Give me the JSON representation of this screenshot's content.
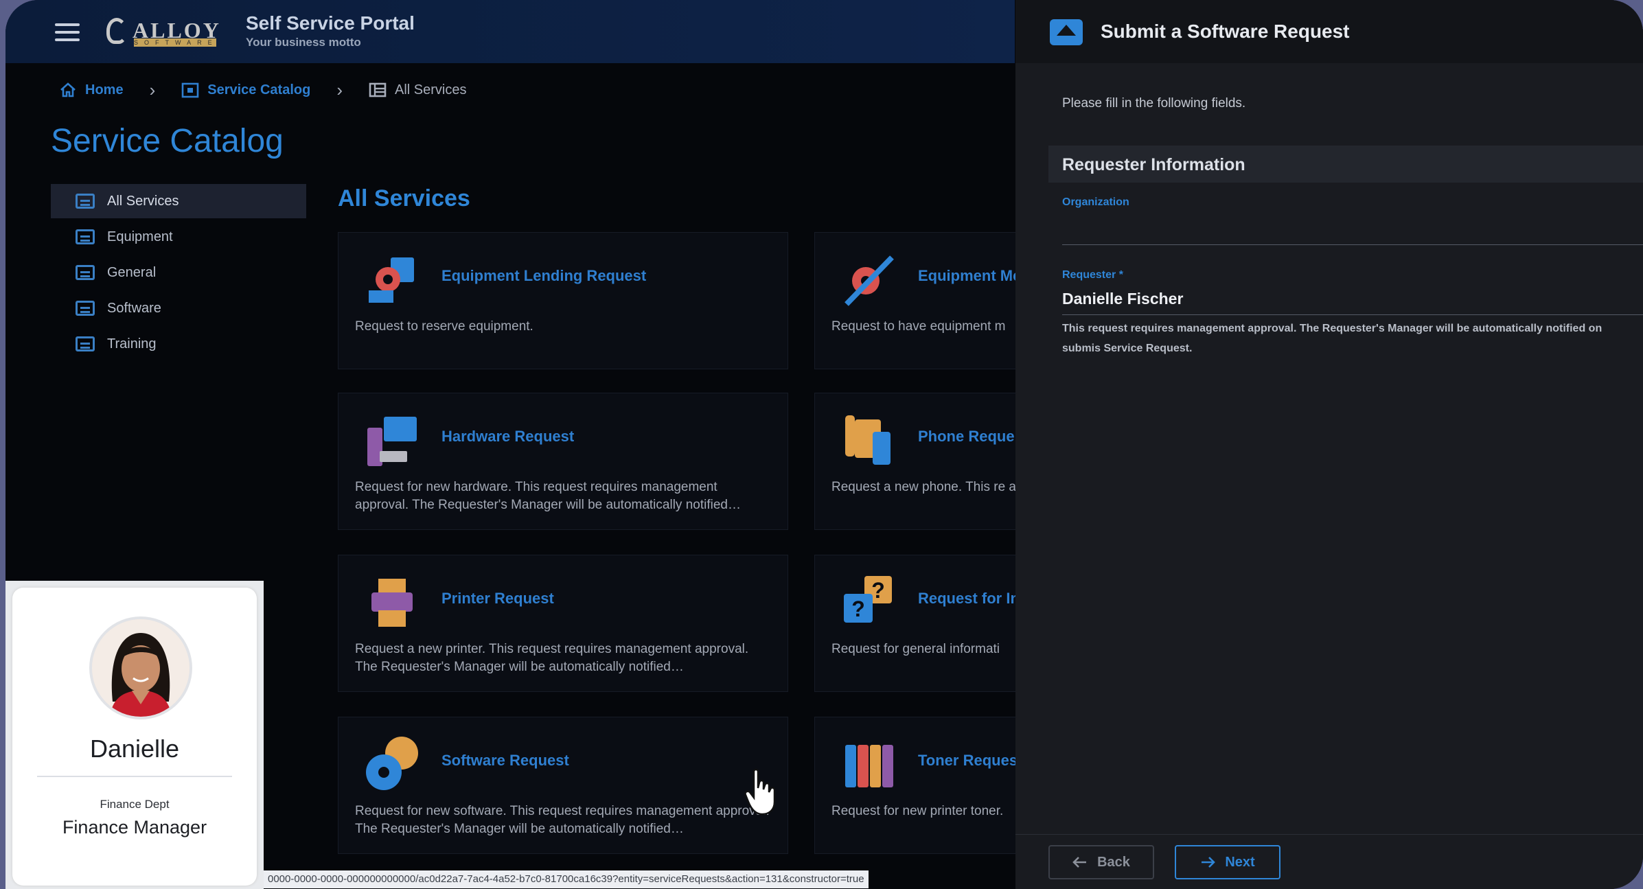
{
  "header": {
    "logo_text": "ALLOY",
    "logo_sub": "SOFTWARE",
    "portal_title": "Self Service Portal",
    "portal_subtitle": "Your business motto"
  },
  "breadcrumb": [
    "Home",
    "Service Catalog",
    "All Services"
  ],
  "page_title": "Service Catalog",
  "sidebar": {
    "items": [
      {
        "label": "All Services",
        "active": true
      },
      {
        "label": "Equipment"
      },
      {
        "label": "General"
      },
      {
        "label": "Software"
      },
      {
        "label": "Training"
      }
    ]
  },
  "section_title": "All Services",
  "cards": [
    {
      "title": "Equipment Lending Request",
      "desc": "Request to reserve equipment.",
      "icon": "equipment-lending-icon"
    },
    {
      "title": "Equipment Me",
      "desc": "Request to have equipment m",
      "icon": "equipment-maintenance-icon"
    },
    {
      "title": "Hardware Request",
      "desc": "Request for new hardware. This request requires management approval. The Requester's Manager will be automatically notified…",
      "icon": "hardware-icon"
    },
    {
      "title": "Phone Reque",
      "desc": "Request a new phone. This re approval. The Requester's Ma",
      "icon": "phone-icon"
    },
    {
      "title": "Printer Request",
      "desc": "Request a new printer. This request requires management approval. The Requester's Manager will be automatically notified…",
      "icon": "printer-icon"
    },
    {
      "title": "Request for In",
      "desc": "Request for general informati",
      "icon": "question-icon"
    },
    {
      "title": "Software Request",
      "desc": "Request for new software. This request requires management approval. The Requester's Manager will be automatically notified…",
      "icon": "software-disc-icon"
    },
    {
      "title": "Toner Reques",
      "desc": "Request for new printer toner.",
      "icon": "toner-icon"
    }
  ],
  "panel": {
    "title": "Submit a Software Request",
    "intro": "Please fill in the following fields.",
    "section": "Requester Information",
    "organization_label": "Organization",
    "requester_label": "Requester *",
    "requester_value": "Danielle Fischer",
    "note": "This request requires management approval. The Requester's Manager will be automatically notified on submis Service Request.",
    "back_label": "Back",
    "next_label": "Next"
  },
  "profile": {
    "name": "Danielle",
    "dept": "Finance Dept",
    "role": "Finance Manager"
  },
  "status_url": "0000-0000-0000-000000000000/ac0d22a7-7ac4-4a52-b7c0-81700ca16c39?entity=serviceRequests&action=131&constructor=true",
  "colors": {
    "accent": "#2f86d8",
    "background": "#05070b",
    "panel": "#191b20"
  }
}
